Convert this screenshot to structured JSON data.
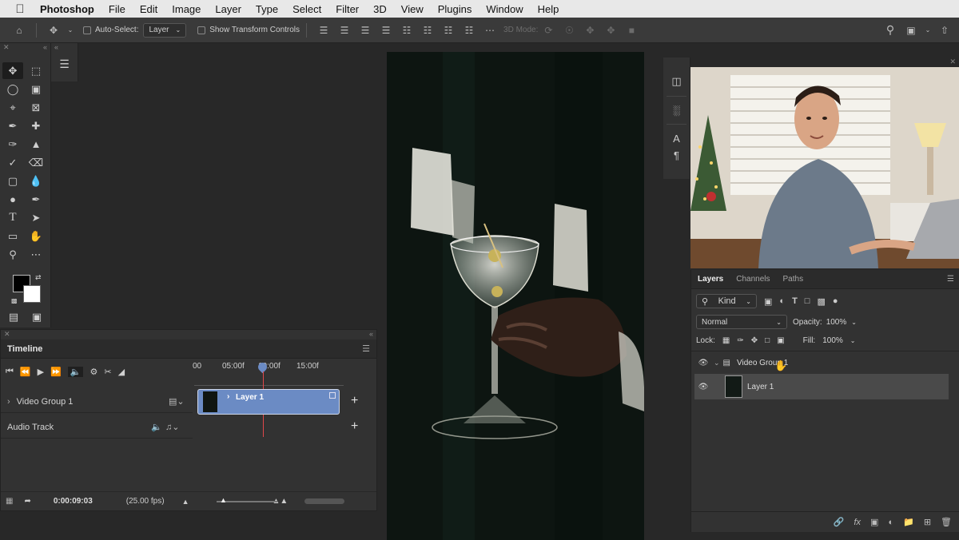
{
  "menubar": {
    "app_name": "Photoshop",
    "items": [
      "File",
      "Edit",
      "Image",
      "Layer",
      "Type",
      "Select",
      "Filter",
      "3D",
      "View",
      "Plugins",
      "Window",
      "Help"
    ]
  },
  "options_bar": {
    "auto_select_label": "Auto-Select:",
    "auto_select_value": "Layer",
    "show_transform_label": "Show Transform Controls",
    "mode_3d_label": "3D Mode:"
  },
  "timeline": {
    "tab_label": "Timeline",
    "ruler_ticks": [
      "00",
      "05:00f",
      "10:00f",
      "15:00f"
    ],
    "video_group_label": "Video Group 1",
    "clip_label": "Layer 1",
    "audio_track_label": "Audio Track",
    "current_time": "0:00:09:03",
    "fps": "(25.00 fps)"
  },
  "layers_panel": {
    "tabs": [
      "Layers",
      "Channels",
      "Paths"
    ],
    "kind_label": "Kind",
    "blend_mode": "Normal",
    "opacity_label": "Opacity:",
    "opacity_value": "100%",
    "lock_label": "Lock:",
    "fill_label": "Fill:",
    "fill_value": "100%",
    "group_name": "Video Group 1",
    "layer_name": "Layer 1"
  },
  "colors": {
    "clip_fill": "#6b8bc4",
    "playhead": "#e0484a",
    "selected_layer": "#4a4a4a"
  }
}
